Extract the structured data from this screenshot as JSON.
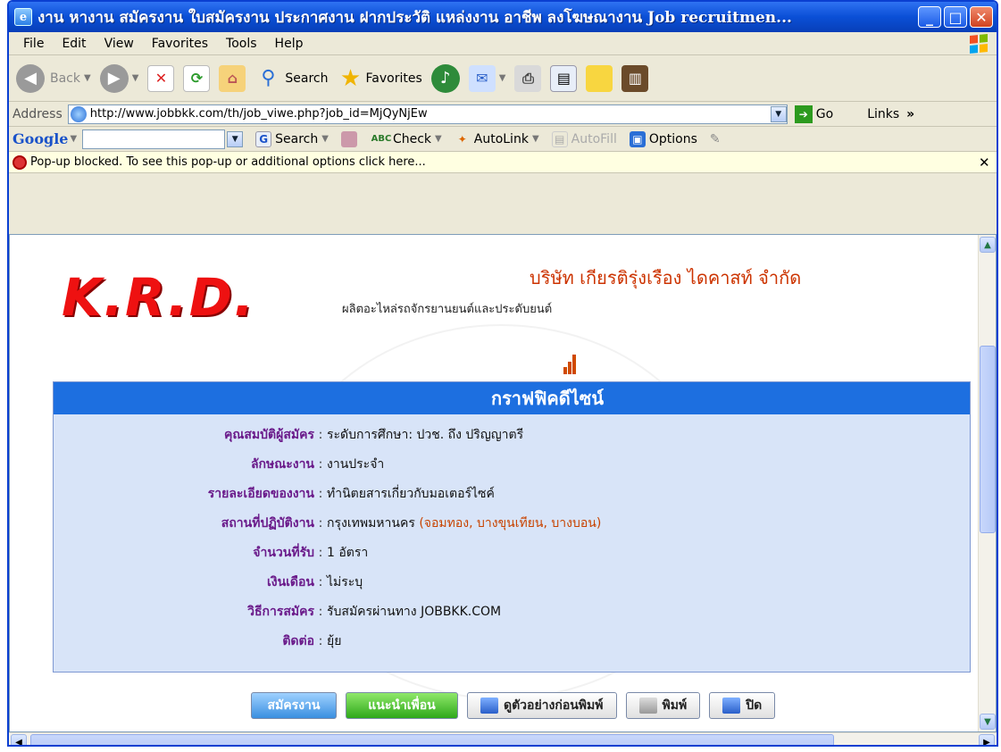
{
  "window": {
    "title": "งาน หางาน สมัครงาน ใบสมัครงาน ประกาศงาน ฝากประวัติ แหล่งงาน อาชีพ ลงโฆษณางาน Job recruitmen..."
  },
  "menu": [
    "File",
    "Edit",
    "View",
    "Favorites",
    "Tools",
    "Help"
  ],
  "toolbar": {
    "back": "Back",
    "search": "Search",
    "favorites": "Favorites"
  },
  "address": {
    "label": "Address",
    "url": "http://www.jobbkk.com/th/job_viwe.php?job_id=MjQyNjEw",
    "go": "Go",
    "links": "Links"
  },
  "googlebar": {
    "logo": "Google",
    "search": "Search",
    "check": "Check",
    "autolink": "AutoLink",
    "autofill": "AutoFill",
    "options": "Options"
  },
  "popup": {
    "message": "Pop-up blocked. To see this pop-up or additional options click here..."
  },
  "company": {
    "logo_text": "K.R.D.",
    "name": "บริษัท เกียรติรุ่งเรือง ไดคาสท์ จำกัด",
    "description": "ผลิตอะไหล่รถจักรยานยนต์และประดับยนต์"
  },
  "job": {
    "title": "กราฟฟิคดีไซน์",
    "rows": [
      {
        "label": "คุณสมบัติผู้สมัคร",
        "sep": ":",
        "value": "ระดับการศึกษา: ปวช. ถึง ปริญญาตรี",
        "extra": ""
      },
      {
        "label": "ลักษณะงาน",
        "sep": ":",
        "value": "งานประจำ",
        "extra": ""
      },
      {
        "label": "รายละเอียดของงาน",
        "sep": ":",
        "value": "ทำนิตยสารเกี่ยวกับมอเตอร์ไซค์",
        "extra": ""
      },
      {
        "label": "สถานที่ปฏิบัติงาน",
        "sep": ":",
        "value": "กรุงเทพมหานคร",
        "extra": "(จอมทอง, บางขุนเทียน, บางบอน)"
      },
      {
        "label": "จำนวนที่รับ",
        "sep": ":",
        "value": "1 อัตรา",
        "extra": ""
      },
      {
        "label": "เงินเดือน",
        "sep": ":",
        "value": "ไม่ระบุ",
        "extra": ""
      },
      {
        "label": "วิธีการสมัคร",
        "sep": ":",
        "value": "รับสมัครผ่านทาง JOBBKK.COM",
        "extra": ""
      },
      {
        "label": "ติดต่อ",
        "sep": ":",
        "value": "ยุ้ย",
        "extra": ""
      }
    ]
  },
  "actions": {
    "apply": "สมัครงาน",
    "recommend": "แนะนำเพื่อน",
    "preview": "ดูตัวอย่างก่อนพิมพ์",
    "print": "พิมพ์",
    "close": "ปิด"
  },
  "colors": {
    "header_blue": "#1d6fe0",
    "label_purple": "#6a1a8a",
    "company_orange": "#cc3300",
    "logo_red": "#e11111"
  }
}
